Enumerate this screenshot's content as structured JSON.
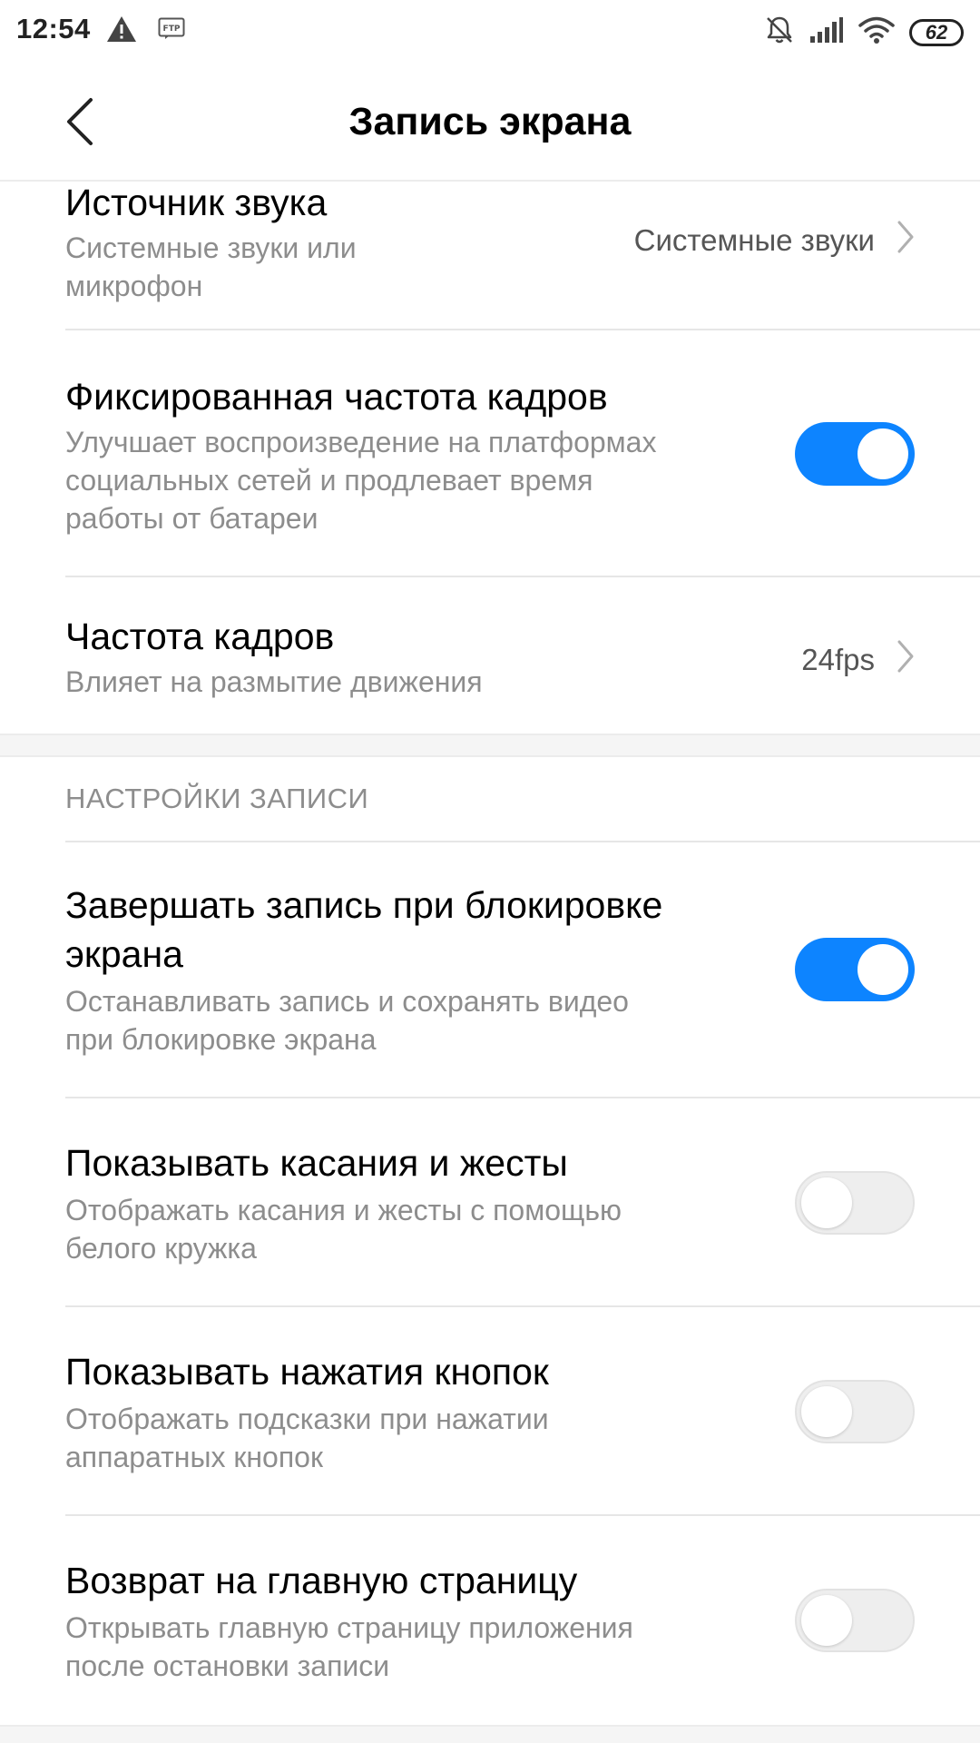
{
  "status_bar": {
    "time": "12:54",
    "battery": "62",
    "icons": [
      "warning-icon",
      "ftp-icon",
      "bell-muted-icon",
      "signal-icon",
      "wifi-icon",
      "battery-icon"
    ]
  },
  "header": {
    "title": "Запись экрана",
    "back_icon": "chevron-left-icon"
  },
  "settings": {
    "sound_source": {
      "title": "Источник звука",
      "subtitle_line1": "Системные звуки или",
      "subtitle_line2": "микрофон",
      "value": "Системные звуки"
    },
    "fixed_fps": {
      "title": "Фиксированная частота кадров",
      "subtitle_line1": "Улучшает воспроизведение на платформах",
      "subtitle_line2": "социальных сетей и продлевает время",
      "subtitle_line3": "работы от батареи",
      "enabled": true
    },
    "frame_rate": {
      "title": "Частота кадров",
      "subtitle": "Влияет на размытие движения",
      "value": "24fps"
    }
  },
  "recording_section": {
    "header": "НАСТРОЙКИ ЗАПИСИ",
    "stop_on_lock": {
      "title_line1": "Завершать запись при блокировке",
      "title_line2": "экрана",
      "subtitle_line1": "Останавливать запись и сохранять видео",
      "subtitle_line2": "при блокировке экрана",
      "enabled": true
    },
    "show_touches": {
      "title": "Показывать касания и жесты",
      "subtitle_line1": "Отображать касания и жесты с помощью",
      "subtitle_line2": "белого кружка",
      "enabled": false
    },
    "show_buttons": {
      "title": "Показывать нажатия кнопок",
      "subtitle_line1": "Отображать подсказки при нажатии",
      "subtitle_line2": "аппаратных кнопок",
      "enabled": false
    },
    "return_home": {
      "title": "Возврат на главную страницу",
      "subtitle_line1": "Открывать главную страницу приложения",
      "subtitle_line2": "после остановки записи",
      "enabled": false
    }
  },
  "colors": {
    "accent": "#0d84ff",
    "toggle_off": "#eeeeee",
    "secondary_text": "#8d8d8d"
  }
}
